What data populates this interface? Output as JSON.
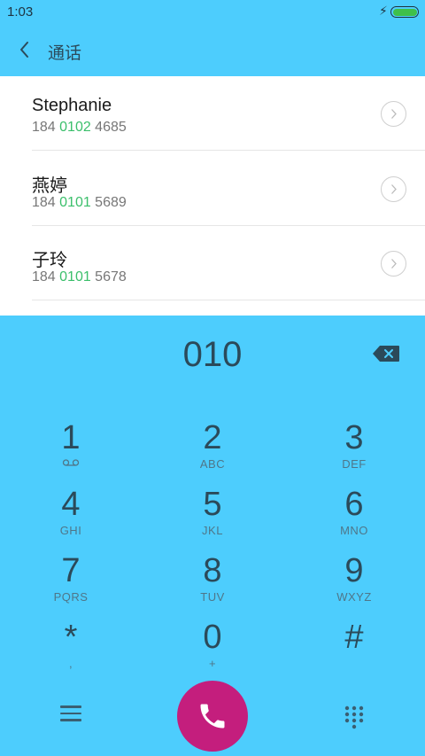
{
  "status_bar": {
    "time": "1:03"
  },
  "header": {
    "title": "通话"
  },
  "contacts": [
    {
      "name": "Stephanie",
      "number_prefix": "184 ",
      "number_match": "0102",
      "number_rest": " 4685"
    },
    {
      "name": "燕婷",
      "number_prefix": "184 ",
      "number_match": "0101",
      "number_rest": " 5689"
    },
    {
      "name": "子玲",
      "number_prefix": "184 ",
      "number_match": "0101",
      "number_rest": " 5678"
    }
  ],
  "dialer": {
    "input": "010",
    "keys": [
      {
        "digit": "1",
        "letters": ""
      },
      {
        "digit": "2",
        "letters": "ABC"
      },
      {
        "digit": "3",
        "letters": "DEF"
      },
      {
        "digit": "4",
        "letters": "GHI"
      },
      {
        "digit": "5",
        "letters": "JKL"
      },
      {
        "digit": "6",
        "letters": "MNO"
      },
      {
        "digit": "7",
        "letters": "PQRS"
      },
      {
        "digit": "8",
        "letters": "TUV"
      },
      {
        "digit": "9",
        "letters": "WXYZ"
      },
      {
        "digit": "*",
        "letters": ","
      },
      {
        "digit": "0",
        "letters": "+"
      },
      {
        "digit": "#",
        "letters": ""
      }
    ]
  },
  "colors": {
    "background": "#4dcdfd",
    "call_button": "#c41e7d",
    "match_highlight": "#3bbf6b",
    "battery": "#3fc04a"
  },
  "icons": {
    "back": "chevron-left-icon",
    "detail": "chevron-right-circle-icon",
    "backspace": "backspace-icon",
    "voicemail": "voicemail-icon",
    "menu": "menu-icon",
    "call": "phone-icon",
    "keypad": "keypad-icon"
  }
}
